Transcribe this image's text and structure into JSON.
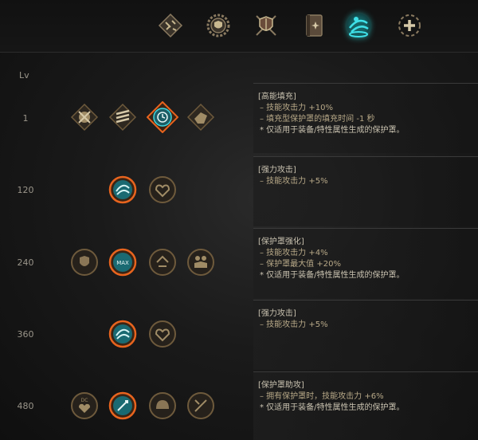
{
  "tabs": [
    {
      "icon": "diamond-skills-icon",
      "active": false
    },
    {
      "icon": "gear-shield-icon",
      "active": false
    },
    {
      "icon": "shield-swords-icon",
      "active": false
    },
    {
      "icon": "spellbook-icon",
      "active": false
    },
    {
      "icon": "swirl-aura-icon",
      "active": true
    },
    {
      "icon": "dotted-circle-plus-icon",
      "active": false
    }
  ],
  "header": {
    "lv_label": "Lv"
  },
  "rows": [
    {
      "level": "1",
      "nodes": [
        "skull-swords-icon",
        "stacked-blades-icon",
        "clock-icon",
        "fist-icon"
      ],
      "selected_index": 2,
      "panel": {
        "title": "[高能填充]",
        "lines": [
          "– 技能攻击力 +10%",
          "– 填充型保护罩的填充时间 -1 秒"
        ],
        "note": "* 仅适用于装备/特性属性生成的保护罩。"
      }
    },
    {
      "level": "120",
      "nodes": [
        "swirl-aura-icon",
        "heart-fist-icon"
      ],
      "selected_index": 0,
      "panel": {
        "title": "[强力攻击]",
        "lines": [
          "– 技能攻击力 +5%"
        ],
        "note": ""
      }
    },
    {
      "level": "240",
      "nodes": [
        "fist-shield-icon",
        "max-badge-icon",
        "shield-arrows-icon",
        "twin-figures-icon"
      ],
      "selected_index": 1,
      "max_label": "MAX",
      "panel": {
        "title": "[保护罩强化]",
        "lines": [
          "– 技能攻击力 +4%",
          "– 保护罩最大值 +20%"
        ],
        "note": "* 仅适用于装备/特性属性生成的保护罩。"
      }
    },
    {
      "level": "360",
      "nodes": [
        "swirl-aura-icon",
        "heart-fist-icon"
      ],
      "selected_index": 0,
      "panel": {
        "title": "[强力攻击]",
        "lines": [
          "– 技能攻击力 +5%"
        ],
        "note": ""
      }
    },
    {
      "level": "480",
      "nodes": [
        "dc-heart-icon",
        "shield-sword-icon",
        "helmet-icon",
        "crossed-sword-icon"
      ],
      "selected_index": 1,
      "dc_label": "DC",
      "panel": {
        "title": "[保护罩助攻]",
        "lines": [
          "– 拥有保护罩时，技能攻击力 +6%"
        ],
        "note": "* 仅适用于装备/特性属性生成的保护罩。"
      }
    }
  ],
  "colors": {
    "accent_orange": "#e8641e",
    "accent_teal": "#2ab8c0",
    "node_bronze": "#6e5a3c"
  }
}
